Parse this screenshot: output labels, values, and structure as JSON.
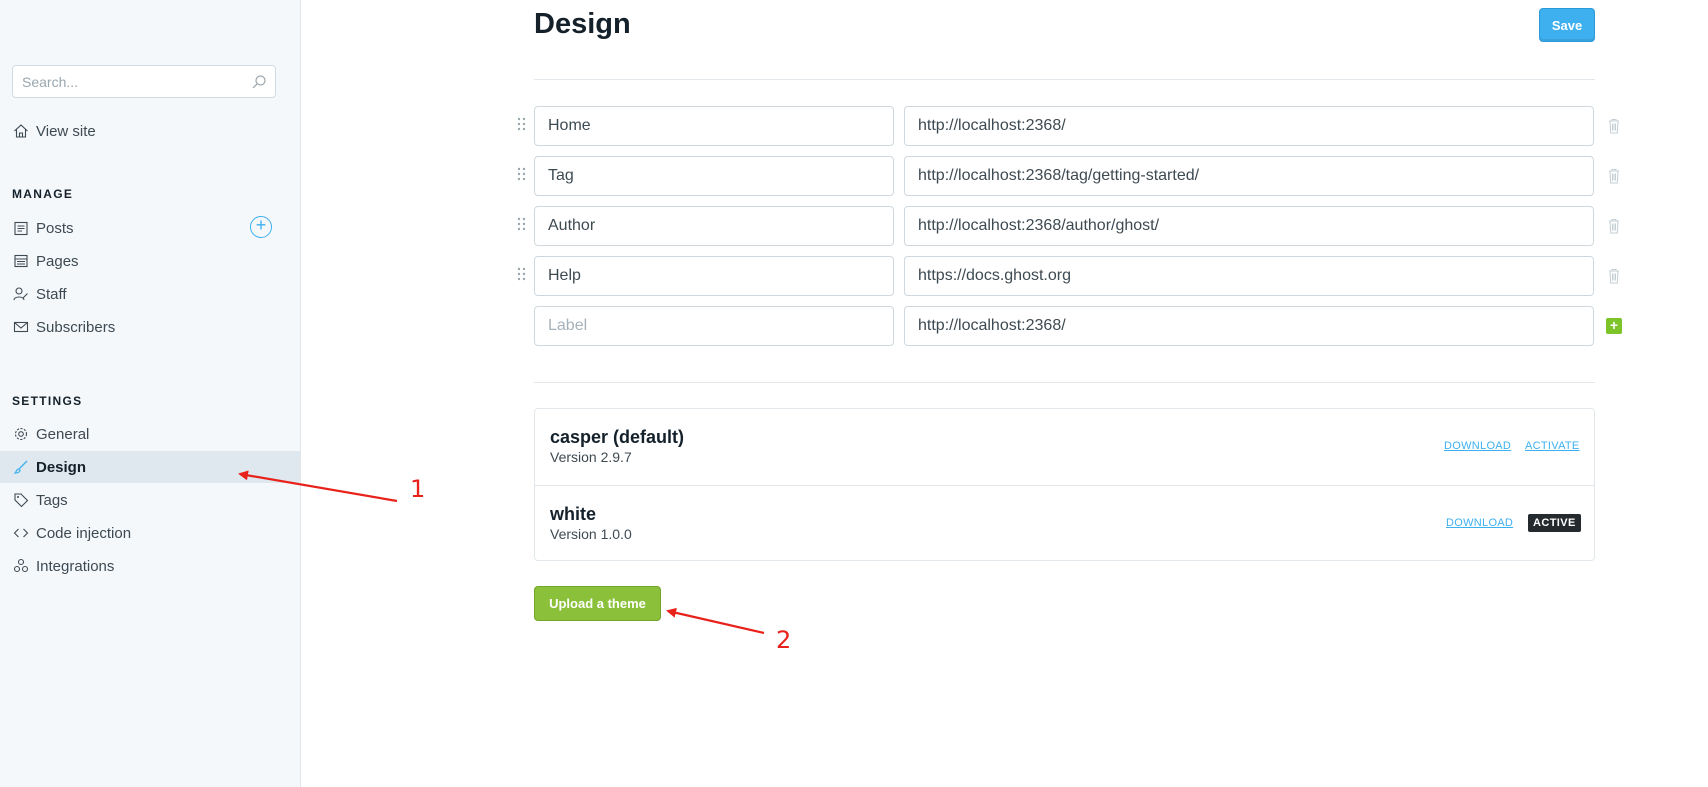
{
  "sidebar": {
    "search_placeholder": "Search...",
    "view_site": "View site",
    "manage_label": "MANAGE",
    "manage_items": [
      "Posts",
      "Pages",
      "Staff",
      "Subscribers"
    ],
    "settings_label": "SETTINGS",
    "settings_items": [
      "General",
      "Design",
      "Tags",
      "Code injection",
      "Integrations"
    ],
    "active_item": "Design"
  },
  "header": {
    "title": "Design",
    "save_label": "Save"
  },
  "navigation": {
    "items": [
      {
        "label": "Home",
        "url": "http://localhost:2368/"
      },
      {
        "label": "Tag",
        "url": "http://localhost:2368/tag/getting-started/"
      },
      {
        "label": "Author",
        "url": "http://localhost:2368/author/ghost/"
      },
      {
        "label": "Help",
        "url": "https://docs.ghost.org"
      }
    ],
    "new_item": {
      "label_placeholder": "Label",
      "url": "http://localhost:2368/"
    }
  },
  "themes": {
    "items": [
      {
        "name": "casper (default)",
        "version": "Version 2.9.7",
        "download": "DOWNLOAD",
        "action": "ACTIVATE"
      },
      {
        "name": "white",
        "version": "Version 1.0.0",
        "download": "DOWNLOAD",
        "status": "ACTIVE"
      }
    ],
    "upload_label": "Upload a theme"
  },
  "annotations": {
    "marker_1": "1",
    "marker_2": "2"
  },
  "colors": {
    "accent_blue": "#3eb0ef",
    "green": "#8ac03a",
    "annotation_red": "#e8221b"
  }
}
